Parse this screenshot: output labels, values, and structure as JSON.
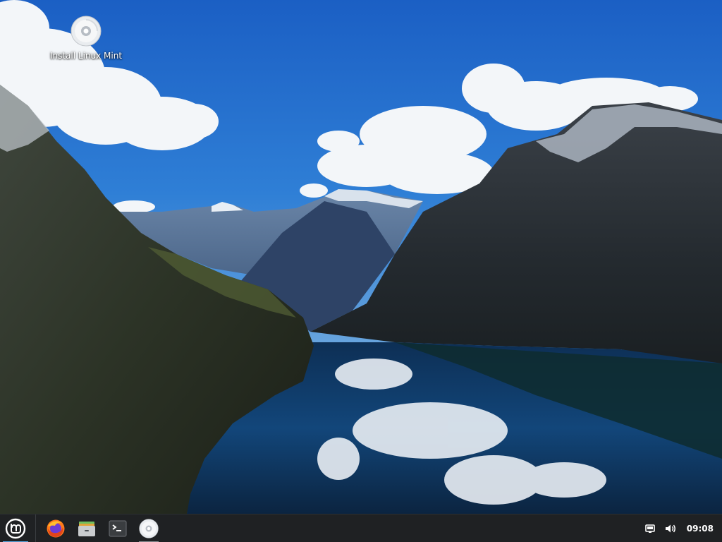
{
  "desktop": {
    "icons": [
      {
        "label": "Install Linux Mint",
        "icon": "disc-icon"
      }
    ]
  },
  "panel": {
    "menu_icon": "linux-mint-logo-icon",
    "launchers": [
      {
        "icon": "firefox-icon"
      },
      {
        "icon": "file-manager-icon"
      },
      {
        "icon": "terminal-icon"
      },
      {
        "icon": "disc-icon"
      }
    ],
    "tray": {
      "network_icon": "network-wired-icon",
      "volume_icon": "volume-icon",
      "clock": "09:08"
    }
  },
  "colors": {
    "panel_bg": "#1f2123",
    "accent": "#5aa9e6",
    "sky": "#1f6fd0"
  }
}
